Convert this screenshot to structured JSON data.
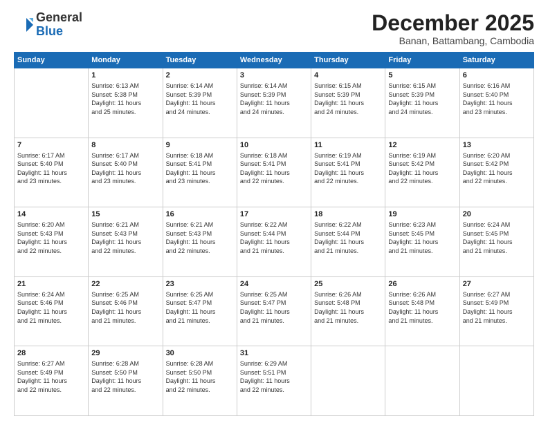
{
  "logo": {
    "general": "General",
    "blue": "Blue"
  },
  "title": "December 2025",
  "subtitle": "Banan, Battambang, Cambodia",
  "header_days": [
    "Sunday",
    "Monday",
    "Tuesday",
    "Wednesday",
    "Thursday",
    "Friday",
    "Saturday"
  ],
  "weeks": [
    [
      {
        "day": "",
        "info": ""
      },
      {
        "day": "1",
        "info": "Sunrise: 6:13 AM\nSunset: 5:38 PM\nDaylight: 11 hours\nand 25 minutes."
      },
      {
        "day": "2",
        "info": "Sunrise: 6:14 AM\nSunset: 5:39 PM\nDaylight: 11 hours\nand 24 minutes."
      },
      {
        "day": "3",
        "info": "Sunrise: 6:14 AM\nSunset: 5:39 PM\nDaylight: 11 hours\nand 24 minutes."
      },
      {
        "day": "4",
        "info": "Sunrise: 6:15 AM\nSunset: 5:39 PM\nDaylight: 11 hours\nand 24 minutes."
      },
      {
        "day": "5",
        "info": "Sunrise: 6:15 AM\nSunset: 5:39 PM\nDaylight: 11 hours\nand 24 minutes."
      },
      {
        "day": "6",
        "info": "Sunrise: 6:16 AM\nSunset: 5:40 PM\nDaylight: 11 hours\nand 23 minutes."
      }
    ],
    [
      {
        "day": "7",
        "info": "Sunrise: 6:17 AM\nSunset: 5:40 PM\nDaylight: 11 hours\nand 23 minutes."
      },
      {
        "day": "8",
        "info": "Sunrise: 6:17 AM\nSunset: 5:40 PM\nDaylight: 11 hours\nand 23 minutes."
      },
      {
        "day": "9",
        "info": "Sunrise: 6:18 AM\nSunset: 5:41 PM\nDaylight: 11 hours\nand 23 minutes."
      },
      {
        "day": "10",
        "info": "Sunrise: 6:18 AM\nSunset: 5:41 PM\nDaylight: 11 hours\nand 22 minutes."
      },
      {
        "day": "11",
        "info": "Sunrise: 6:19 AM\nSunset: 5:41 PM\nDaylight: 11 hours\nand 22 minutes."
      },
      {
        "day": "12",
        "info": "Sunrise: 6:19 AM\nSunset: 5:42 PM\nDaylight: 11 hours\nand 22 minutes."
      },
      {
        "day": "13",
        "info": "Sunrise: 6:20 AM\nSunset: 5:42 PM\nDaylight: 11 hours\nand 22 minutes."
      }
    ],
    [
      {
        "day": "14",
        "info": "Sunrise: 6:20 AM\nSunset: 5:43 PM\nDaylight: 11 hours\nand 22 minutes."
      },
      {
        "day": "15",
        "info": "Sunrise: 6:21 AM\nSunset: 5:43 PM\nDaylight: 11 hours\nand 22 minutes."
      },
      {
        "day": "16",
        "info": "Sunrise: 6:21 AM\nSunset: 5:43 PM\nDaylight: 11 hours\nand 22 minutes."
      },
      {
        "day": "17",
        "info": "Sunrise: 6:22 AM\nSunset: 5:44 PM\nDaylight: 11 hours\nand 21 minutes."
      },
      {
        "day": "18",
        "info": "Sunrise: 6:22 AM\nSunset: 5:44 PM\nDaylight: 11 hours\nand 21 minutes."
      },
      {
        "day": "19",
        "info": "Sunrise: 6:23 AM\nSunset: 5:45 PM\nDaylight: 11 hours\nand 21 minutes."
      },
      {
        "day": "20",
        "info": "Sunrise: 6:24 AM\nSunset: 5:45 PM\nDaylight: 11 hours\nand 21 minutes."
      }
    ],
    [
      {
        "day": "21",
        "info": "Sunrise: 6:24 AM\nSunset: 5:46 PM\nDaylight: 11 hours\nand 21 minutes."
      },
      {
        "day": "22",
        "info": "Sunrise: 6:25 AM\nSunset: 5:46 PM\nDaylight: 11 hours\nand 21 minutes."
      },
      {
        "day": "23",
        "info": "Sunrise: 6:25 AM\nSunset: 5:47 PM\nDaylight: 11 hours\nand 21 minutes."
      },
      {
        "day": "24",
        "info": "Sunrise: 6:25 AM\nSunset: 5:47 PM\nDaylight: 11 hours\nand 21 minutes."
      },
      {
        "day": "25",
        "info": "Sunrise: 6:26 AM\nSunset: 5:48 PM\nDaylight: 11 hours\nand 21 minutes."
      },
      {
        "day": "26",
        "info": "Sunrise: 6:26 AM\nSunset: 5:48 PM\nDaylight: 11 hours\nand 21 minutes."
      },
      {
        "day": "27",
        "info": "Sunrise: 6:27 AM\nSunset: 5:49 PM\nDaylight: 11 hours\nand 21 minutes."
      }
    ],
    [
      {
        "day": "28",
        "info": "Sunrise: 6:27 AM\nSunset: 5:49 PM\nDaylight: 11 hours\nand 22 minutes."
      },
      {
        "day": "29",
        "info": "Sunrise: 6:28 AM\nSunset: 5:50 PM\nDaylight: 11 hours\nand 22 minutes."
      },
      {
        "day": "30",
        "info": "Sunrise: 6:28 AM\nSunset: 5:50 PM\nDaylight: 11 hours\nand 22 minutes."
      },
      {
        "day": "31",
        "info": "Sunrise: 6:29 AM\nSunset: 5:51 PM\nDaylight: 11 hours\nand 22 minutes."
      },
      {
        "day": "",
        "info": ""
      },
      {
        "day": "",
        "info": ""
      },
      {
        "day": "",
        "info": ""
      }
    ]
  ]
}
